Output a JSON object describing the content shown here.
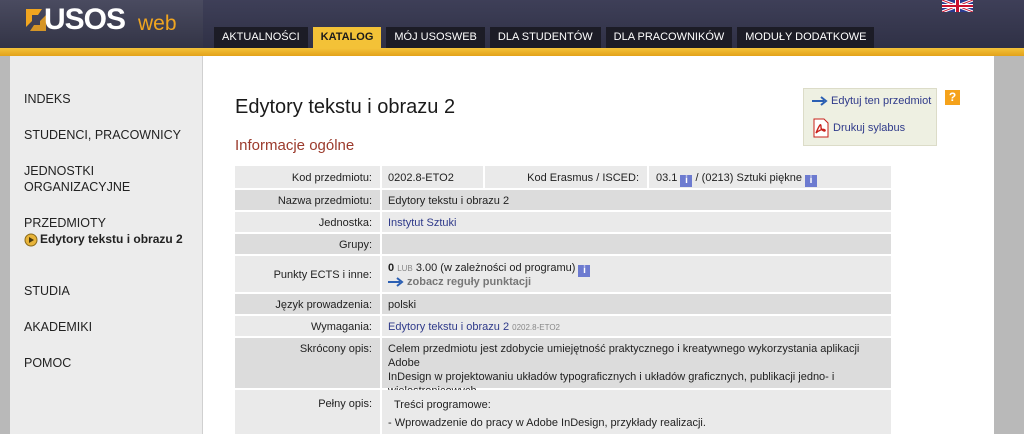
{
  "header": {
    "logo_main": "USOS",
    "logo_suffix": "web",
    "nav": [
      "AKTUALNOŚCI",
      "KATALOG",
      "MÓJ USOSWEB",
      "DLA STUDENTÓW",
      "DLA PRACOWNIKÓW",
      "MODUŁY DODATKOWE"
    ],
    "active_nav": "KATALOG"
  },
  "sidebar": {
    "items": [
      {
        "label": "INDEKS"
      },
      {
        "label": "STUDENCI, PRACOWNICY"
      },
      {
        "label": "JEDNOSTKI ORGANIZACYJNE"
      },
      {
        "label": "PRZEDMIOTY"
      },
      {
        "label": "STUDIA"
      },
      {
        "label": "AKADEMIKI"
      },
      {
        "label": "POMOC"
      }
    ],
    "sub_item": "Edytory tekstu i obrazu 2"
  },
  "page": {
    "title": "Edytory tekstu i obrazu 2",
    "section": "Informacje ogólne"
  },
  "actions": {
    "edit": "Edytuj ten przedmiot",
    "print": "Drukuj sylabus",
    "help": "?"
  },
  "details": {
    "kod_label": "Kod przedmiotu:",
    "kod_value": "0202.8-ETO2",
    "erasmus_label": "Kod Erasmus / ISCED:",
    "erasmus_code": "03.1",
    "isced_value": "/ (0213) Sztuki piękne",
    "nazwa_label": "Nazwa przedmiotu:",
    "nazwa_value": "Edytory tekstu i obrazu 2",
    "jednostka_label": "Jednostka:",
    "jednostka_value": "Instytut Sztuki",
    "grupy_label": "Grupy:",
    "ects_label": "Punkty ECTS i inne:",
    "ects_min": "0",
    "ects_lub": "LUB",
    "ects_max": "3.00 (w zależności od programu)",
    "ects_rules_link": "zobacz reguły punktacji",
    "jezyk_label": "Język prowadzenia:",
    "jezyk_value": "polski",
    "wymagania_label": "Wymagania:",
    "wymagania_link": "Edytory tekstu i obrazu 2",
    "wymagania_code": "0202.8-ETO2",
    "opis_label": "Skrócony opis:",
    "opis_line1": "Celem przedmiotu jest zdobycie umiejętność praktycznego i kreatywnego wykorzystania aplikacji Adobe",
    "opis_line2": "InDesign w projektowaniu układów typograficznych i układów graficznych, publikacji jedno- i",
    "opis_line3": "wielostronicowych.",
    "pelny_label": "Pełny opis:",
    "pelny_line1": "Treści programowe:",
    "pelny_line2": "- Wprowadzenie do pracy w Adobe InDesign, przykłady realizacji."
  },
  "colors": {
    "header_bg": "#3e3f58",
    "accent_gold": "#f3c237",
    "section_red": "#9b3a2c",
    "link_blue": "#2f3a8a",
    "help_orange": "#f5a21a"
  }
}
